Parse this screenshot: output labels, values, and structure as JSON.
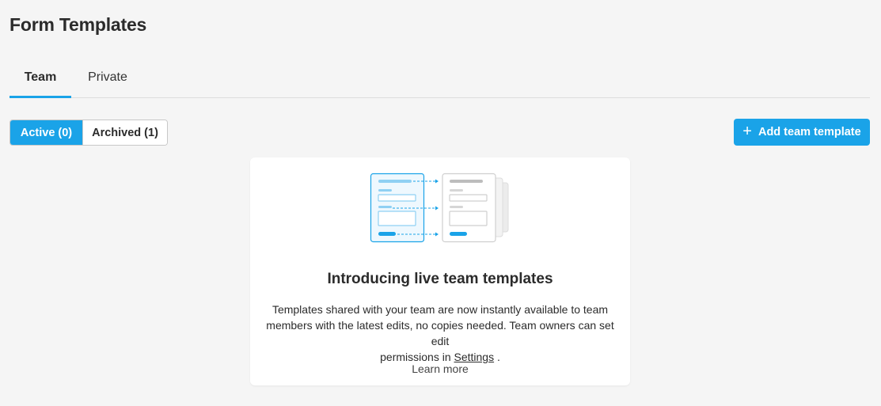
{
  "page": {
    "title": "Form Templates"
  },
  "tabs": [
    {
      "label": "Team",
      "active": true
    },
    {
      "label": "Private",
      "active": false
    }
  ],
  "filter": {
    "active_label": "Active (0)",
    "archived_label": "Archived (1)"
  },
  "actions": {
    "add_button_label": "Add team template",
    "add_button_icon": "plus-icon"
  },
  "card": {
    "illustration_icon": "live-templates-illustration",
    "heading": "Introducing live team templates",
    "body_line1": "Templates shared with your team are now instantly available to team",
    "body_line2": "members with the latest edits, no copies needed. Team owners can set edit",
    "body_line3_prefix": "permissions in",
    "settings_link": "Settings",
    "body_line3_suffix": ".",
    "learn_more": "Learn more"
  },
  "colors": {
    "accent": "#1aa3e8",
    "background": "#f5f5f5",
    "card": "#ffffff",
    "text": "#2b2b2b"
  }
}
